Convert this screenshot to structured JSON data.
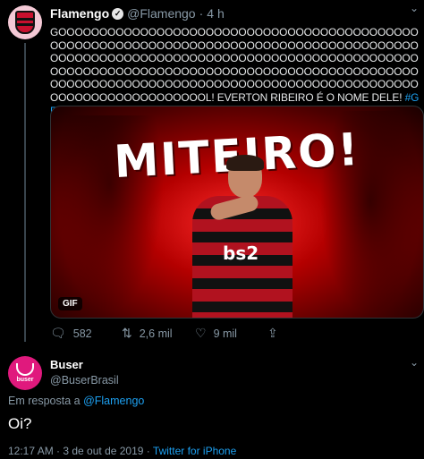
{
  "tweet": {
    "author_name": "Flamengo",
    "handle": "@Flamengo",
    "separator": "·",
    "time": "4 h",
    "body": "GOOOOOOOOOOOOOOOOOOOOOOOOOOOOOOOOOOOOOOOOOOOOOOOOOOOOOOOOOOOOOOOOOOOOOOOOOOOOOOOOOOOOOOOOOOOOOOOOOOOOOOOOOOOOOOOOOOOOOOOOOOOOOOOOOOOOOOOOOOOOOOOOOOOOOOOOOOOOOOOOOOOOOOOOOOOOOOOOOOOOOOOOOOOOOOOOOOOOOOOOOOOOOOOOOOOOOOOOOOOOOOOOOOOOOOOOOOOOOOOOOOOL! EVERTON RIBEIRO É O NOME DELE!",
    "hashtag": "#GRExFLA",
    "media": {
      "title": "MITEIRO!",
      "shirt_sponsor": "bs2",
      "badge": "GIF"
    },
    "actions": {
      "replies": "582",
      "retweets": "2,6 mil",
      "likes": "9 mil"
    },
    "icons": [
      "verified-icon",
      "chevron-down-icon",
      "reply-icon",
      "retweet-icon",
      "like-icon",
      "share-icon"
    ]
  },
  "reply": {
    "author_name": "Buser",
    "handle": "@BuserBrasil",
    "avatar_text": "buser",
    "replying_prefix": "Em resposta a",
    "replying_to": "@Flamengo",
    "body": "Oi?",
    "timestamp": "12:17 AM · 3 de out de 2019 · ",
    "source": "Twitter for iPhone"
  },
  "colors": {
    "background": "#000000",
    "link": "#1da1f2",
    "muted": "#8899a6",
    "flamengo_red": "#c8102e",
    "buser_pink": "#e0197d"
  }
}
